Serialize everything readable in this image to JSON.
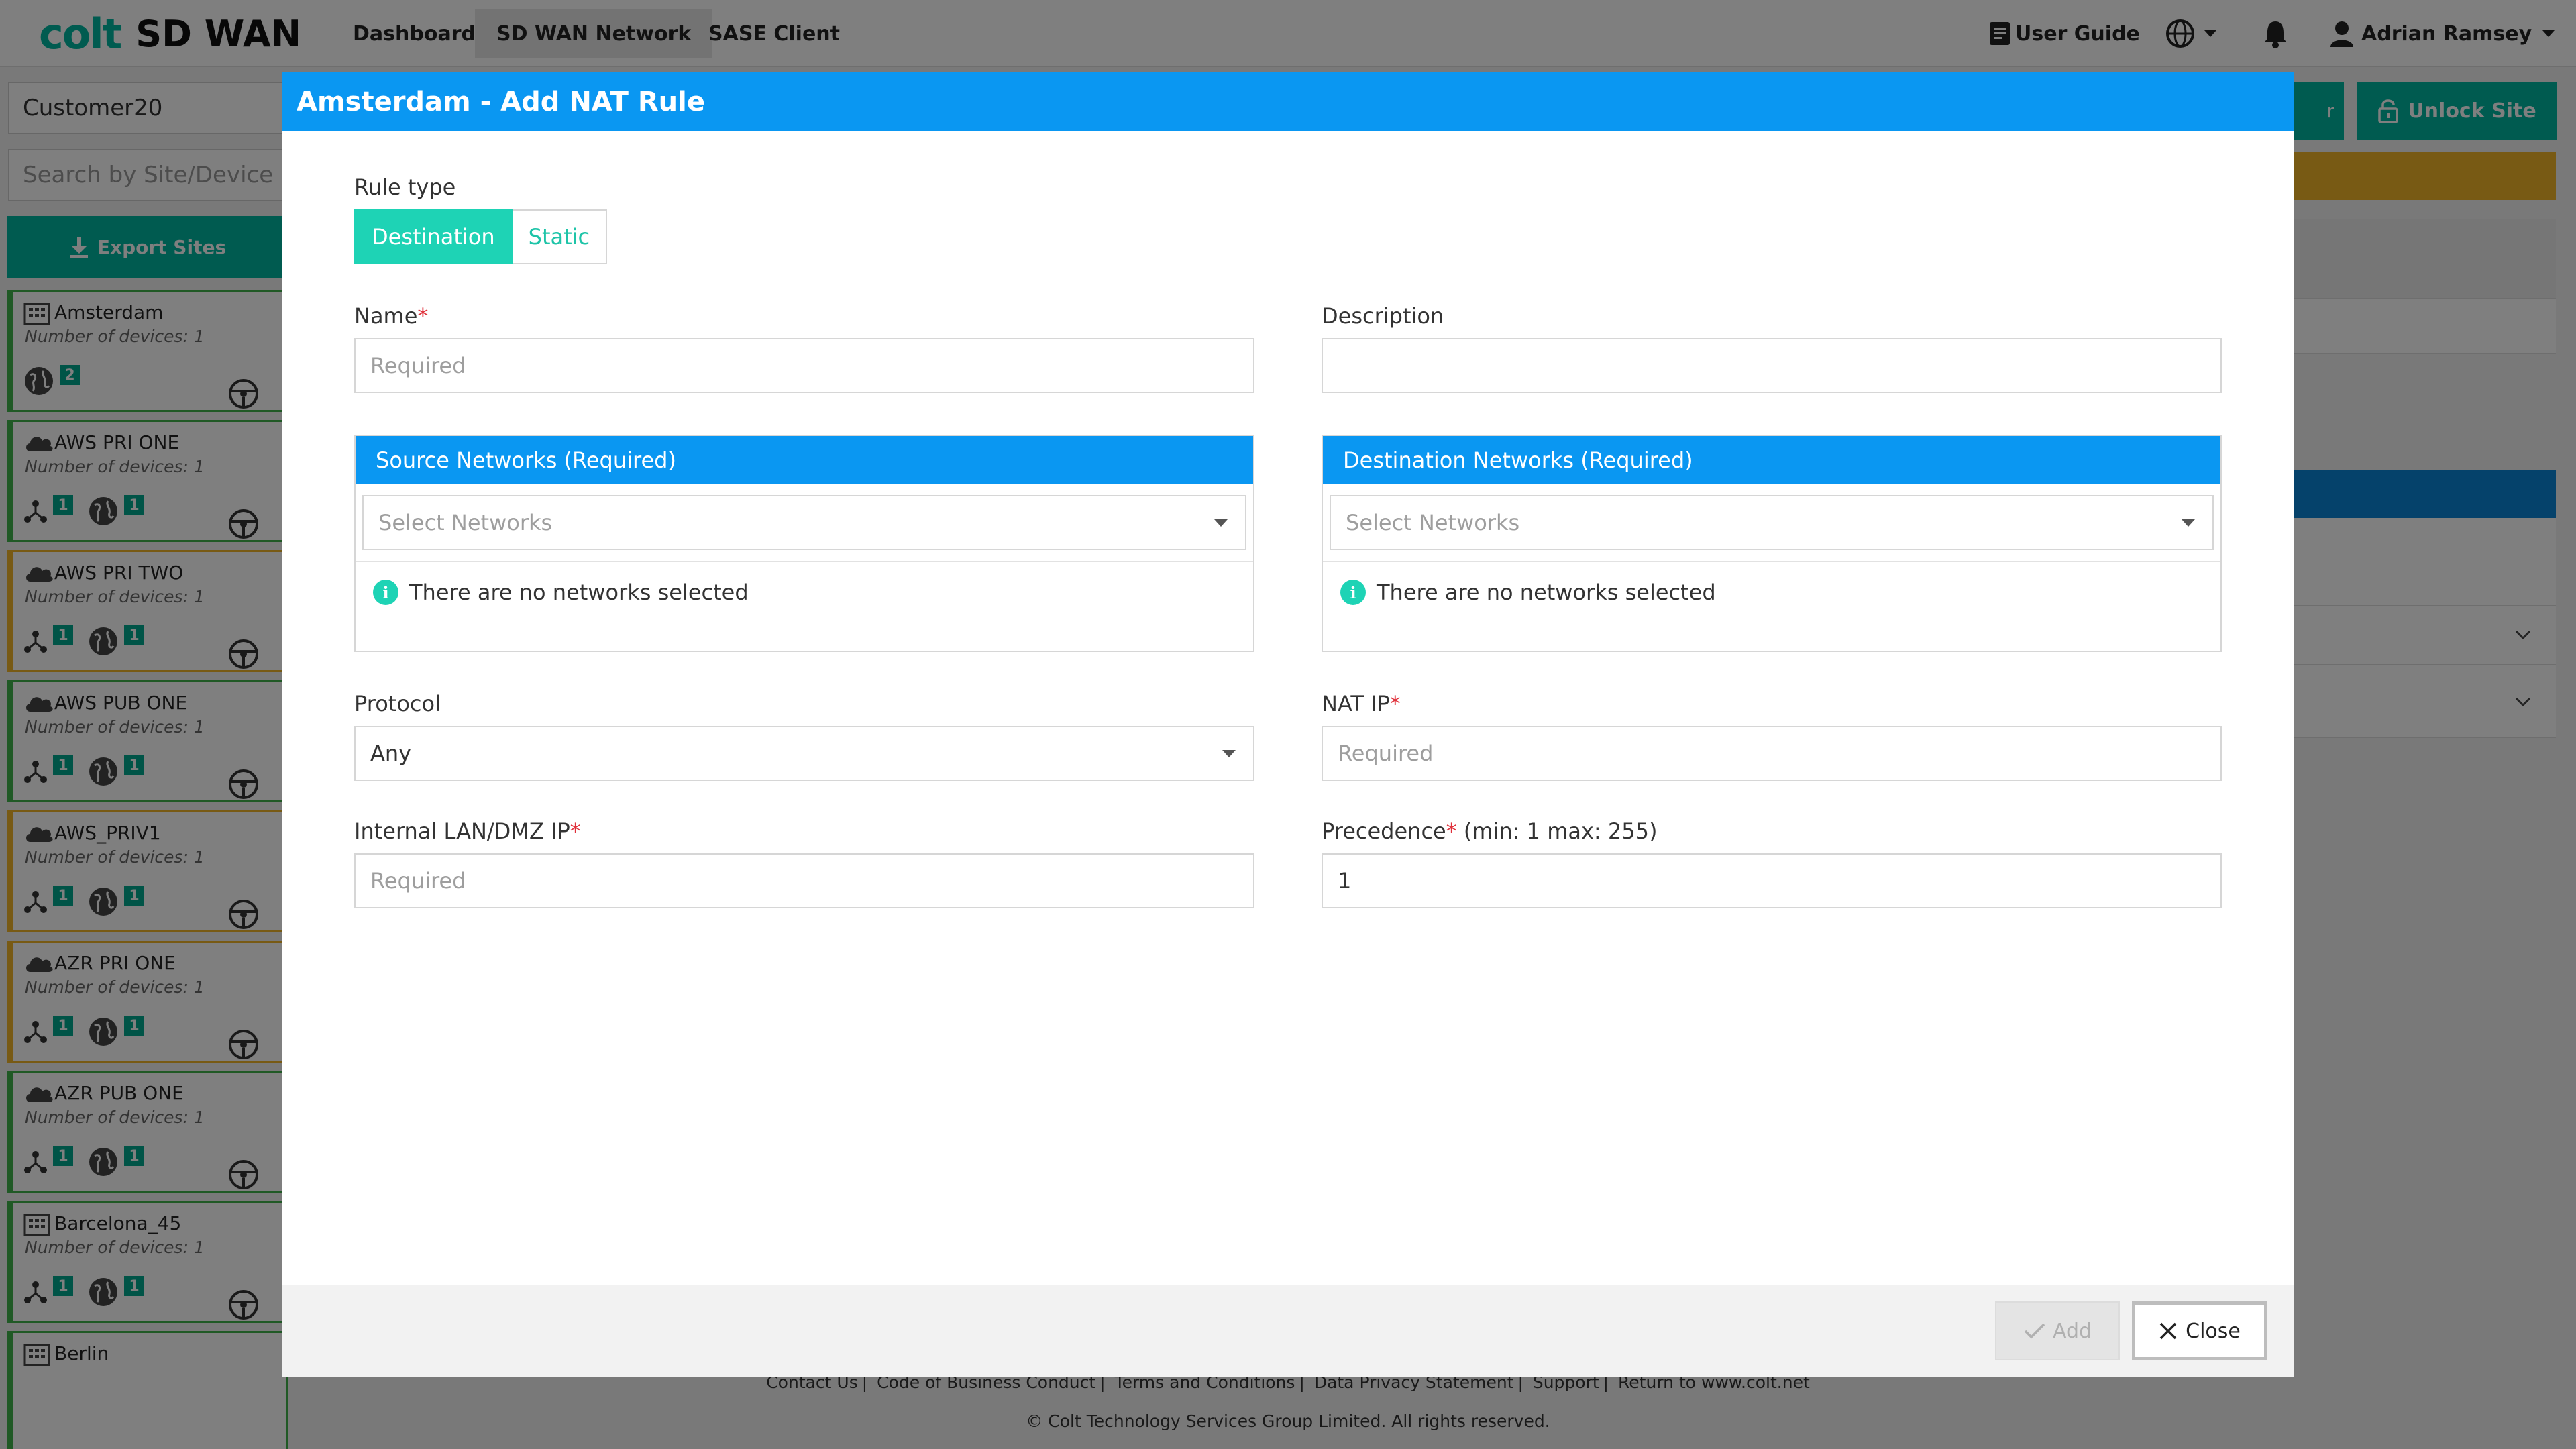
{
  "app": {
    "brand_colt": "colt",
    "brand_sdwan": "SD WAN",
    "nav": [
      "Dashboard",
      "SD WAN Network",
      "SASE Client"
    ],
    "user_guide": "User Guide",
    "user_name": "Adrian Ramsey",
    "accent": "#00b7a0"
  },
  "sidebar": {
    "customer": "Customer20",
    "search_placeholder": "Search by Site/Device",
    "export_label": "Export Sites",
    "sites": [
      {
        "name": "Amsterdam",
        "devices": "Number of devices: 1",
        "type": "building",
        "status": "green",
        "badges": [
          "2"
        ]
      },
      {
        "name": "AWS PRI ONE",
        "devices": "Number of devices: 1",
        "type": "cloud",
        "status": "green",
        "badges": [
          "1",
          "1"
        ]
      },
      {
        "name": "AWS PRI TWO",
        "devices": "Number of devices: 1",
        "type": "cloud",
        "status": "orange",
        "badges": [
          "1",
          "1"
        ]
      },
      {
        "name": "AWS PUB ONE",
        "devices": "Number of devices: 1",
        "type": "cloud",
        "status": "green",
        "badges": [
          "1",
          "1"
        ]
      },
      {
        "name": "AWS_PRIV1",
        "devices": "Number of devices: 1",
        "type": "cloud",
        "status": "orange",
        "badges": [
          "1",
          "1"
        ]
      },
      {
        "name": "AZR PRI ONE",
        "devices": "Number of devices: 1",
        "type": "cloud",
        "status": "orange",
        "badges": [
          "1",
          "1"
        ]
      },
      {
        "name": "AZR PUB ONE",
        "devices": "Number of devices: 1",
        "type": "cloud",
        "status": "green",
        "badges": [
          "1",
          "1"
        ]
      },
      {
        "name": "Barcelona_45",
        "devices": "Number of devices: 1",
        "type": "building",
        "status": "green",
        "badges": [
          "1",
          "1"
        ]
      },
      {
        "name": "Berlin",
        "devices": "",
        "type": "building",
        "status": "green",
        "badges": []
      }
    ]
  },
  "background": {
    "unlock_site": "Unlock Site",
    "teal_fragment": "r"
  },
  "footer": {
    "links": [
      "Contact Us",
      "Code of Business Conduct",
      "Terms and Conditions",
      "Data Privacy Statement",
      "Support",
      "Return to www.colt.net"
    ],
    "copyright": "© Colt Technology Services Group Limited. All rights reserved."
  },
  "modal": {
    "title": "Amsterdam - Add NAT Rule",
    "rule_type_label": "Rule type",
    "rule_type_options": [
      "Destination",
      "Static"
    ],
    "rule_type_selected": "Destination",
    "name_label": "Name",
    "name_placeholder": "Required",
    "description_label": "Description",
    "description_value": "",
    "source_networks_title": "Source Networks (Required)",
    "destination_networks_title": "Destination Networks (Required)",
    "select_networks_placeholder": "Select Networks",
    "no_networks_msg": "There are no networks selected",
    "protocol_label": "Protocol",
    "protocol_value": "Any",
    "nat_ip_label": "NAT IP",
    "nat_ip_placeholder": "Required",
    "internal_ip_label": "Internal LAN/DMZ IP",
    "internal_ip_placeholder": "Required",
    "precedence_label": "Precedence",
    "precedence_hint": "(min: 1 max: 255)",
    "precedence_value": "1",
    "add_label": "Add",
    "close_label": "Close"
  }
}
